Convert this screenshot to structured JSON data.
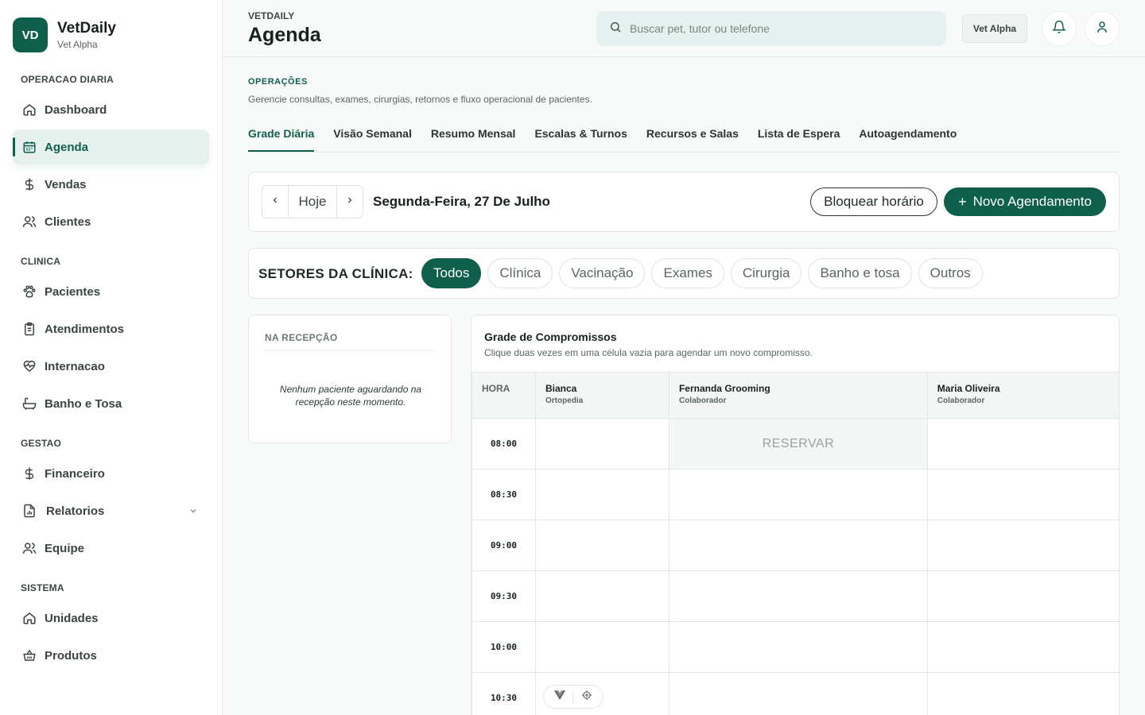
{
  "brand": {
    "initials": "VD",
    "title": "VetDaily",
    "subtitle": "Vet Alpha"
  },
  "sidebar": {
    "sections": [
      {
        "label": "OPERACAO DIARIA",
        "items": [
          {
            "label": "Dashboard",
            "icon": "home-icon"
          },
          {
            "label": "Agenda",
            "icon": "calendar-icon",
            "active": true
          },
          {
            "label": "Vendas",
            "icon": "dollar-icon"
          },
          {
            "label": "Clientes",
            "icon": "users-icon"
          }
        ]
      },
      {
        "label": "CLINICA",
        "items": [
          {
            "label": "Pacientes",
            "icon": "paw-icon"
          },
          {
            "label": "Atendimentos",
            "icon": "clipboard-icon"
          },
          {
            "label": "Internacao",
            "icon": "heart-pulse-icon"
          },
          {
            "label": "Banho e Tosa",
            "icon": "bath-icon"
          }
        ]
      },
      {
        "label": "GESTAO",
        "items": [
          {
            "label": "Financeiro",
            "icon": "dollar-icon"
          },
          {
            "label": "Relatorios",
            "icon": "report-icon",
            "expandable": true
          },
          {
            "label": "Equipe",
            "icon": "users-icon"
          }
        ]
      },
      {
        "label": "SISTEMA",
        "items": [
          {
            "label": "Unidades",
            "icon": "home-icon"
          },
          {
            "label": "Produtos",
            "icon": "basket-icon"
          }
        ]
      }
    ]
  },
  "header": {
    "crumb": "VETDAILY",
    "title": "Agenda",
    "search_placeholder": "Buscar pet, tutor ou telefone",
    "unit_chip": "Vet Alpha"
  },
  "main": {
    "ops_label": "OPERAÇÕES",
    "ops_desc": "Gerencie consultas, exames, cirurgias, retornos e fluxo operacional de pacientes.",
    "tabs": [
      "Grade Diária",
      "Visão Semanal",
      "Resumo Mensal",
      "Escalas & Turnos",
      "Recursos e Salas",
      "Lista de Espera",
      "Autoagendamento"
    ],
    "active_tab": 0,
    "date_bar": {
      "today_label": "Hoje",
      "date": "Segunda-Feira, 27 De Julho",
      "block_label": "Bloquear horário",
      "new_label": "Novo Agendamento"
    },
    "sectors": {
      "label": "SETORES DA CLÍNICA:",
      "chips": [
        "Todos",
        "Clínica",
        "Vacinação",
        "Exames",
        "Cirurgia",
        "Banho e tosa",
        "Outros"
      ],
      "active": 0
    },
    "reception": {
      "title": "NA RECEPÇÃO",
      "empty": "Nenhum paciente aguardando na recepção neste momento."
    },
    "schedule": {
      "title": "Grade de Compromissos",
      "subtitle": "Clique duas vezes em uma célula vazia para agendar um novo compromisso.",
      "hour_header": "HORA",
      "professionals": [
        {
          "name": "Bianca",
          "role": "Ortopedia"
        },
        {
          "name": "Fernanda Grooming",
          "role": "Colaborador"
        },
        {
          "name": "Maria Oliveira",
          "role": "Colaborador"
        }
      ],
      "times": [
        "08:00",
        "08:30",
        "09:00",
        "09:30",
        "10:00",
        "10:30"
      ],
      "reserve_label": "RESERVAR"
    }
  },
  "colors": {
    "primary": "#0f5f4d",
    "accent_bg": "#e6f1ee",
    "search_bg": "#e4f1ee"
  }
}
